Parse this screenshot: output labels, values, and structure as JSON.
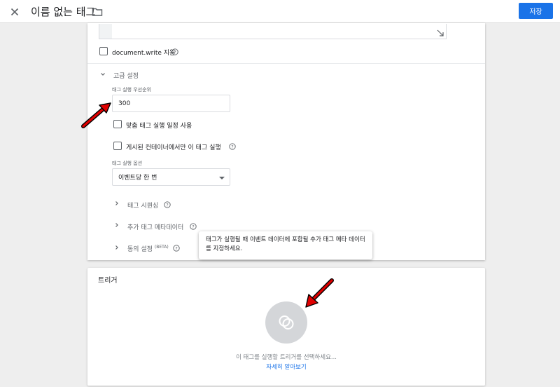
{
  "header": {
    "title": "이름 없는 태그",
    "save_label": "저장"
  },
  "tag_config": {
    "document_write_label": "document.write 지원",
    "advanced_settings_label": "고급 설정",
    "priority_caption": "태그 실행 우선순위",
    "priority_value": "300",
    "custom_schedule_label": "맞춤 태그 실행 일정 사용",
    "published_only_label": "게시된 컨테이너에서만 이 태그 실행",
    "firing_options_caption": "태그 실행 옵션",
    "firing_option_selected": "이벤트당 한 번",
    "tag_sequencing_label": "태그 시퀀싱",
    "additional_metadata_label": "추가 태그 메타데이터",
    "consent_settings_label": "동의 설정",
    "consent_beta": "(BETA)",
    "tooltip_text": "태그가 실행될 때 이벤트 데이터에 포함될 추가 태그 메타 데이터를 지정하세요."
  },
  "triggers": {
    "title": "트리거",
    "hint": "이 태그를 실행할 트리거를 선택하세요...",
    "learn_more": "자세히 알아보기"
  },
  "colors": {
    "accent": "#1a73e8",
    "annotation_arrow": "#e00000"
  }
}
